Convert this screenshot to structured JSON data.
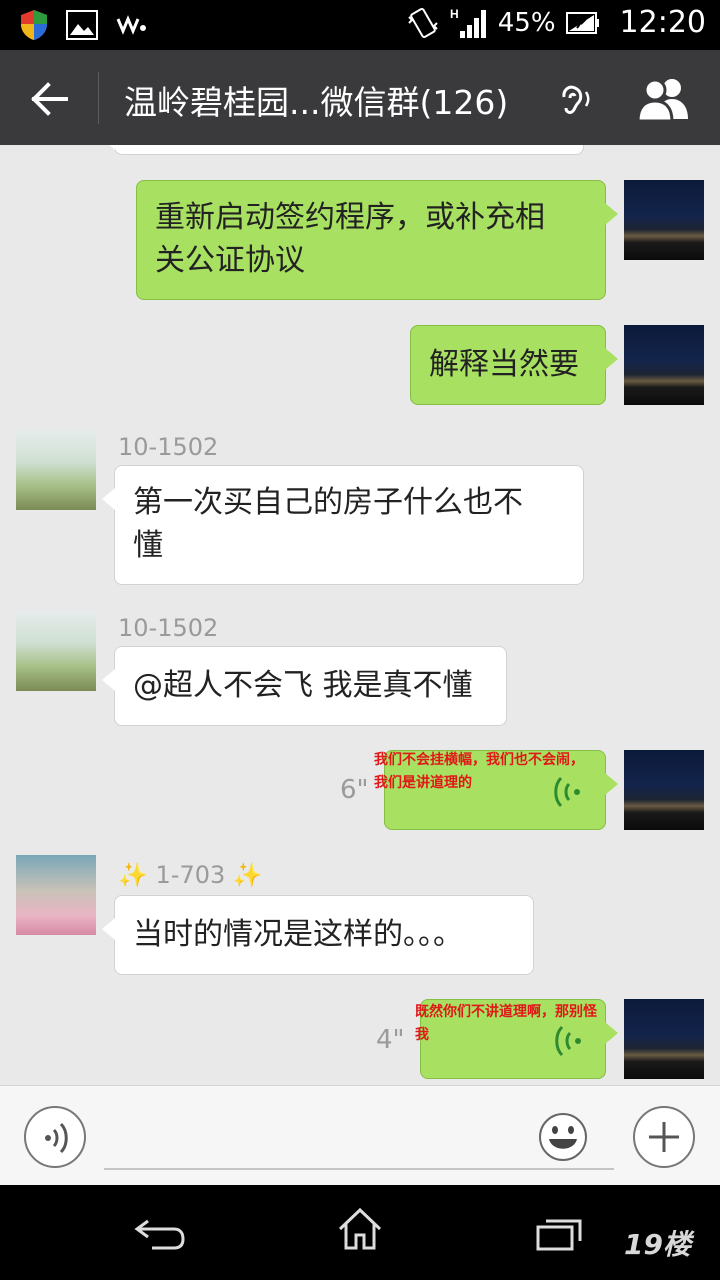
{
  "status_bar": {
    "battery_percent": "45%",
    "time": "12:20",
    "icons": [
      "shield-icon",
      "image-icon",
      "walkman-icon",
      "vibrate-icon",
      "signal-icon",
      "battery-charging-icon"
    ]
  },
  "header": {
    "title": "温岭碧桂园...微信群(126)",
    "back_icon": "arrow-left-icon",
    "earpiece_icon": "ear-icon",
    "members_icon": "group-members-icon"
  },
  "messages": [
    {
      "type": "text",
      "direction": "out",
      "text1": "重新启动签约程序，或补充相",
      "text2": "关公证协议"
    },
    {
      "type": "text",
      "direction": "out",
      "text1": "解释当然要"
    },
    {
      "type": "text",
      "direction": "in",
      "sender": "10-1502",
      "text1": "第一次买自己的房子什么也不",
      "text2": "懂"
    },
    {
      "type": "text",
      "direction": "in",
      "sender": "10-1502",
      "text1": "@超人不会飞 我是真不懂"
    },
    {
      "type": "voice",
      "direction": "out",
      "duration": "6\"",
      "caption1": "我们不会挂横幅，我们也不会闹，",
      "caption2": "我们是讲道理的"
    },
    {
      "type": "text",
      "direction": "in",
      "sender": "✨ 1-703 ✨",
      "text1": "当时的情况是这样的。。。"
    },
    {
      "type": "voice",
      "direction": "out",
      "duration": "4\"",
      "caption1": "既然你们不讲道理啊，那别怪",
      "caption2": "我"
    }
  ],
  "input_bar": {
    "voice_icon": "voice-mode-icon",
    "placeholder": "",
    "emoji_icon": "emoji-smile-icon",
    "plus_icon": "plus-icon"
  },
  "nav_bar": {
    "icons": [
      "nav-back-icon",
      "nav-home-icon",
      "nav-recent-apps-icon"
    ],
    "watermark": "19楼"
  },
  "colors": {
    "status_bar": "#000000",
    "title_bar": "#3a3a3c",
    "chat_background": "#e9e9e9",
    "outgoing_bubble": "#a8e062",
    "incoming_bubble": "#ffffff",
    "voice_caption": "#e01818"
  }
}
